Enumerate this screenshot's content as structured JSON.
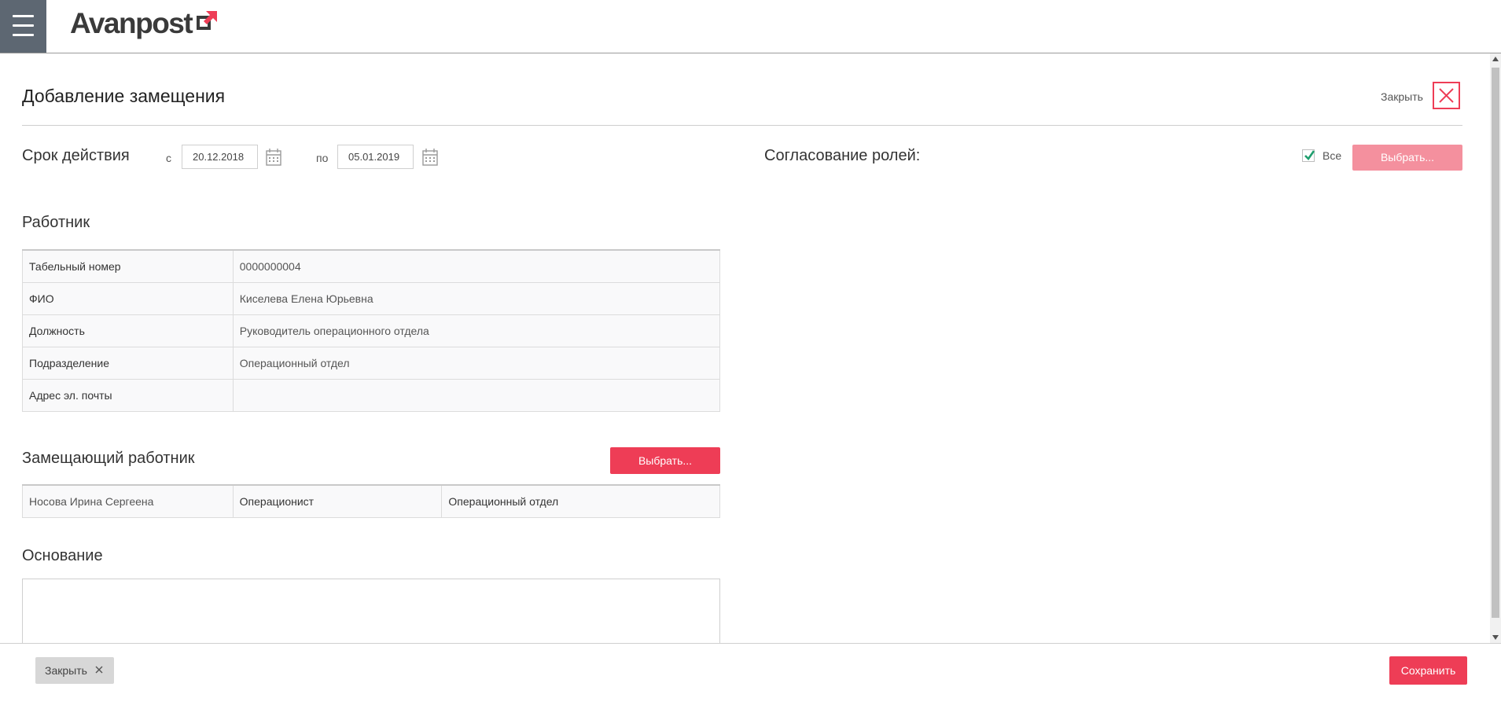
{
  "header": {
    "logo_text": "Avanpost",
    "accent_color": "#ee3d56",
    "menu_icon": "hamburger-menu-icon"
  },
  "page": {
    "title": "Добавление замещения",
    "close_label": "Закрыть"
  },
  "validity": {
    "label": "Срок действия",
    "from_label": "с",
    "from_value": "20.12.2018",
    "to_label": "по",
    "to_value": "05.01.2019"
  },
  "roles": {
    "label": "Согласование ролей:",
    "all_label": "Все",
    "all_checked": true,
    "choose_label": "Выбрать..."
  },
  "employee": {
    "title": "Работник",
    "rows": [
      {
        "label": "Табельный номер",
        "value": "0000000004"
      },
      {
        "label": "ФИО",
        "value": "Киселева Елена Юрьевна"
      },
      {
        "label": "Должность",
        "value": "Руководитель операционного отдела"
      },
      {
        "label": "Подразделение",
        "value": "Операционный отдел"
      },
      {
        "label": "Адрес эл. почты",
        "value": ""
      }
    ]
  },
  "substitute": {
    "title": "Замещающий работник",
    "choose_label": "Выбрать...",
    "row": [
      "Носова Ирина Сергеена",
      "Операционист",
      "Операционный отдел"
    ]
  },
  "basis": {
    "title": "Основание",
    "value": ""
  },
  "footer": {
    "close_label": "Закрыть",
    "save_label": "Сохранить"
  }
}
